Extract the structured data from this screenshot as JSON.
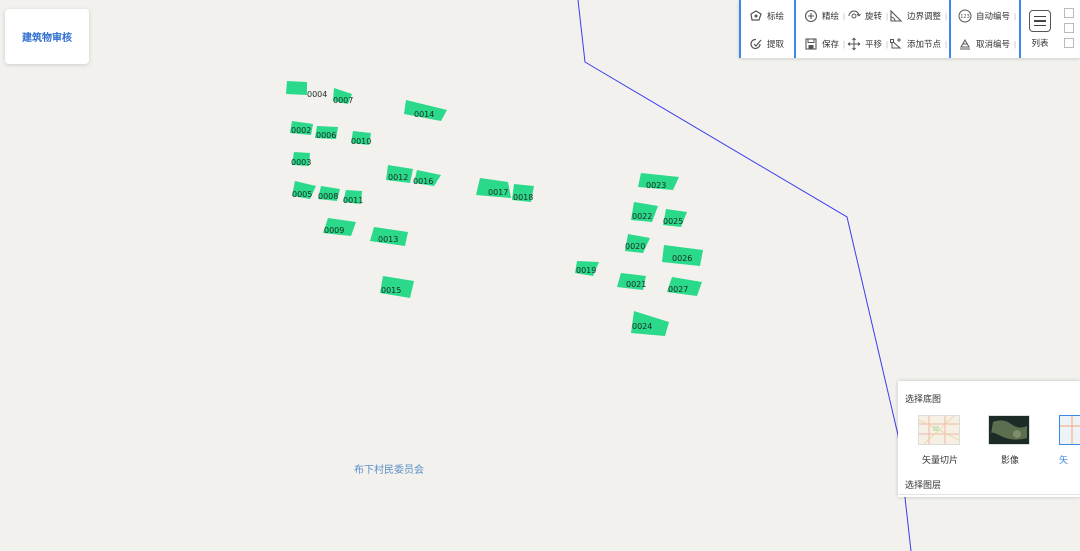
{
  "app": {
    "title": "建筑物审核"
  },
  "toolbar": {
    "group1": [
      {
        "label": "标绘",
        "icon": "draw-polygon-icon"
      },
      {
        "label": "提取",
        "icon": "extract-icon"
      }
    ],
    "group2": [
      {
        "label": "精绘",
        "icon": "plus-circle-icon"
      },
      {
        "label": "旋转",
        "icon": "rotate-icon"
      },
      {
        "label": "边界调整",
        "icon": "boundary-adjust-icon"
      },
      {
        "label": "保存",
        "icon": "save-icon"
      },
      {
        "label": "平移",
        "icon": "move-icon"
      },
      {
        "label": "添加节点",
        "icon": "add-node-icon"
      }
    ],
    "group3": [
      {
        "label": "自动编号",
        "icon": "auto-number-icon"
      },
      {
        "label": "取消编号",
        "icon": "clear-number-icon"
      }
    ],
    "list_label": "列表",
    "separator": "|"
  },
  "map": {
    "place_label": "布下村民委员会",
    "boundary_color": "#3b3bf0",
    "building_color": "#2bd98a",
    "buildings": [
      "0004",
      "0007",
      "0014",
      "0002",
      "0006",
      "0010",
      "0003",
      "0012",
      "0016",
      "0005",
      "0008",
      "0011",
      "0017",
      "0018",
      "0009",
      "0013",
      "0015",
      "0023",
      "0022",
      "0025",
      "0020",
      "0026",
      "0019",
      "0021",
      "0027",
      "0024"
    ]
  },
  "basemap_panel": {
    "title": "选择底图",
    "options": [
      {
        "label": "矢量切片",
        "thumb": "vector-tile-thumb"
      },
      {
        "label": "影像",
        "thumb": "imagery-thumb"
      },
      {
        "label": "矢",
        "thumb": "vector-thumb",
        "selected": true
      }
    ],
    "layer_title": "选择图层"
  }
}
